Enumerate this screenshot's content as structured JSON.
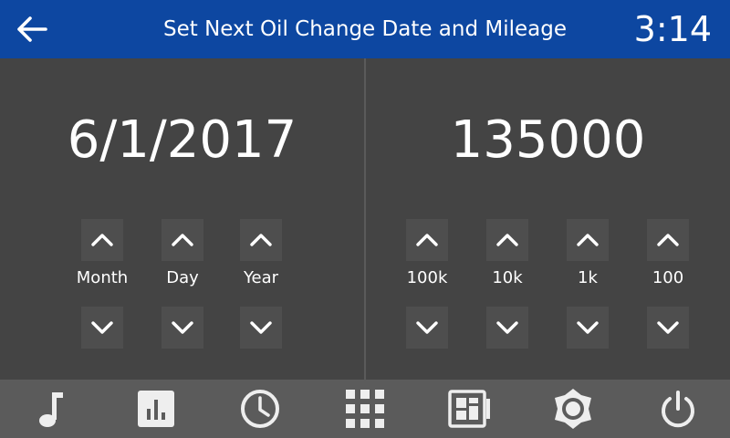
{
  "header": {
    "title": "Set Next Oil Change Date and Mileage",
    "time": "3:14",
    "back_icon": "arrow-left-icon"
  },
  "date_panel": {
    "value": "6/1/2017",
    "fields": [
      {
        "label": "Month"
      },
      {
        "label": "Day"
      },
      {
        "label": "Year"
      }
    ]
  },
  "mileage_panel": {
    "value": "135000",
    "fields": [
      {
        "label": "100k"
      },
      {
        "label": "10k"
      },
      {
        "label": "1k"
      },
      {
        "label": "100"
      }
    ]
  },
  "bottom_nav": [
    {
      "icon": "music-note-icon"
    },
    {
      "icon": "bar-chart-icon"
    },
    {
      "icon": "clock-icon"
    },
    {
      "icon": "apps-grid-icon"
    },
    {
      "icon": "dashboard-icon"
    },
    {
      "icon": "settings-gear-icon"
    },
    {
      "icon": "power-icon"
    }
  ],
  "colors": {
    "header_bg": "#0d47a1",
    "main_bg": "#444444",
    "button_bg": "#4e4e4e",
    "bottom_bar_bg": "#5b5b5b",
    "icon": "#eeeeee"
  }
}
